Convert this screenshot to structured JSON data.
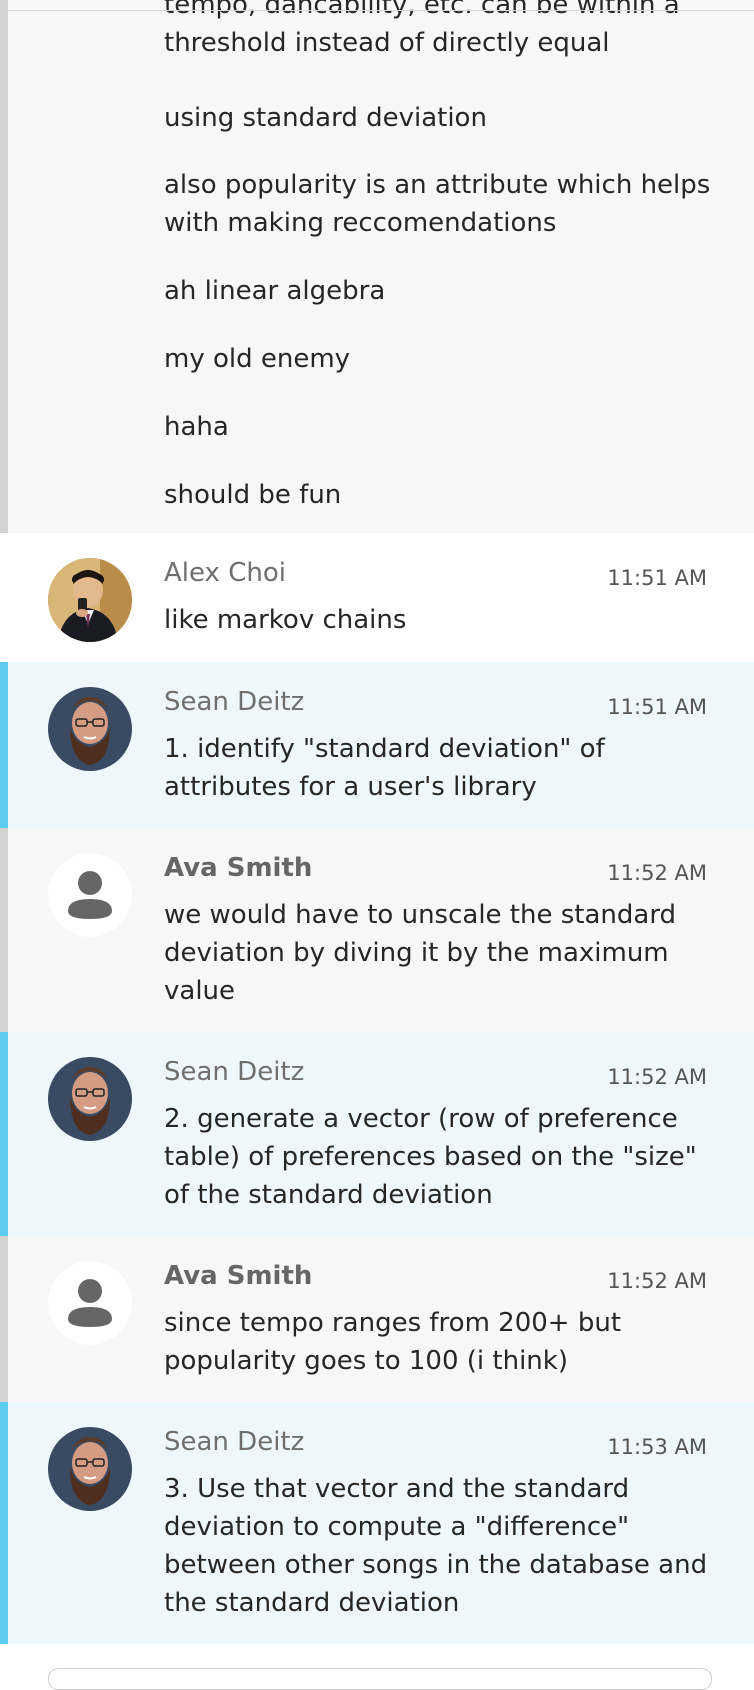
{
  "previous_group": {
    "messages": [
      "tempo, dancability, etc. can be within a threshold instead of directly equal",
      "using standard deviation",
      "also popularity is an attribute which helps with making reccomendations",
      "ah linear algebra",
      "my old enemy",
      "haha",
      "should be fun"
    ]
  },
  "messages": [
    {
      "sender": "Alex Choi",
      "time": "11:51 AM",
      "text": "like markov chains"
    },
    {
      "sender": "Sean Deitz",
      "time": "11:51 AM",
      "text": "1. identify \"standard deviation\" of attributes for a user's library"
    },
    {
      "sender": "Ava Smith",
      "time": "11:52 AM",
      "text": "we would have to unscale the standard deviation by diving it by the maximum value"
    },
    {
      "sender": "Sean Deitz",
      "time": "11:52 AM",
      "text": "2. generate a vector (row of preference table) of preferences based on the \"size\" of the standard deviation"
    },
    {
      "sender": "Ava Smith",
      "time": "11:52 AM",
      "text": "since tempo ranges from 200+ but popularity goes to 100 (i think)"
    },
    {
      "sender": "Sean Deitz",
      "time": "11:53 AM",
      "text": "3. Use that vector and the standard deviation to compute a \"difference\" between other songs in the database and the standard deviation"
    }
  ],
  "colors": {
    "sean_bg": "#eef8fc",
    "sean_bar": "#5ccbf0",
    "ava_bg": "#f7f7f7",
    "ava_bar": "#d3d3d3"
  },
  "icons": {
    "alex_avatar": "user-photo-icon",
    "sean_avatar": "user-photo-icon",
    "ava_avatar": "default-user-icon"
  }
}
